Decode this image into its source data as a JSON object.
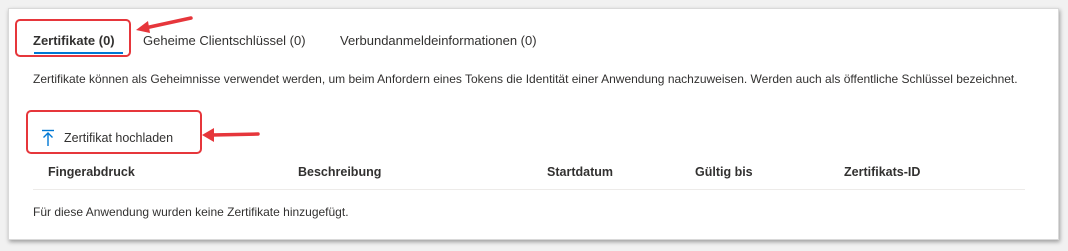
{
  "tabs": [
    {
      "label": "Zertifikate (0)",
      "active": true
    },
    {
      "label": "Geheime Clientschlüssel (0)",
      "active": false
    },
    {
      "label": "Verbundanmeldeinformationen (0)",
      "active": false
    }
  ],
  "description": "Zertifikate können als Geheimnisse verwendet werden, um beim Anfordern eines Tokens die Identität einer Anwendung nachzuweisen. Werden auch als öffentliche Schlüssel bezeichnet.",
  "upload_button": {
    "label": "Zertifikat hochladen",
    "icon": "upload-icon"
  },
  "table": {
    "columns": [
      "Fingerabdruck",
      "Beschreibung",
      "Startdatum",
      "Gültig bis",
      "Zertifikats-ID"
    ],
    "empty_message": "Für diese Anwendung wurden keine Zertifikate hinzugefügt."
  },
  "colors": {
    "accent": "#0078d4",
    "annotation": "#e6363b"
  }
}
